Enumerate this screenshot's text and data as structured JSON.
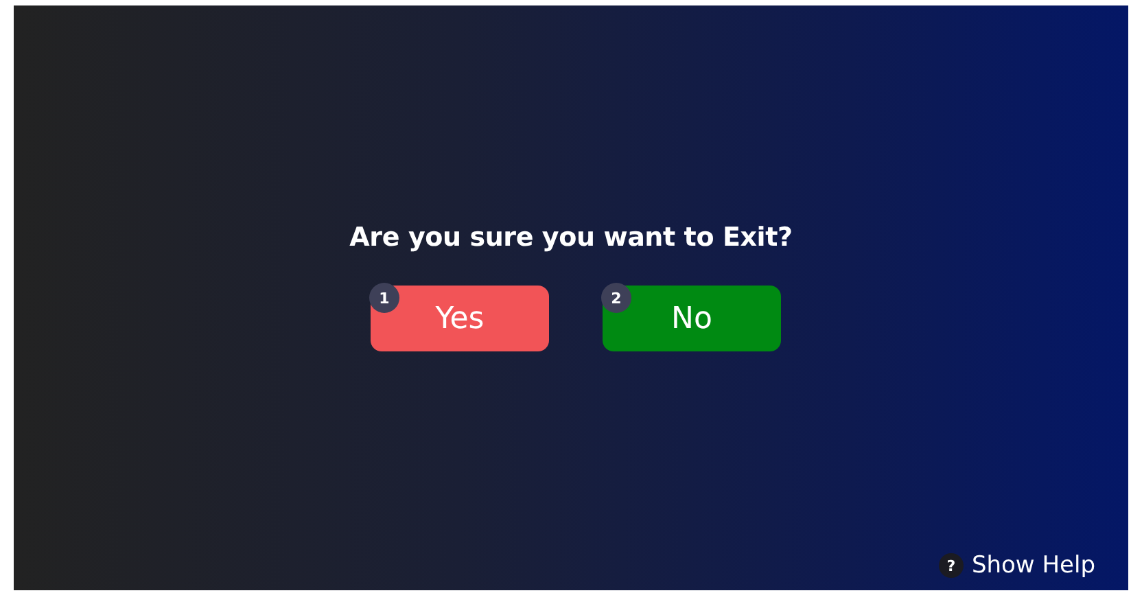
{
  "dialog": {
    "question": "Are you sure you want to Exit?",
    "buttons": [
      {
        "label": "Yes",
        "number": "1",
        "color": "#f25457"
      },
      {
        "label": "No",
        "number": "2",
        "color": "#008a12"
      }
    ]
  },
  "footer": {
    "help_key": "?",
    "help_label": "Show Help"
  }
}
